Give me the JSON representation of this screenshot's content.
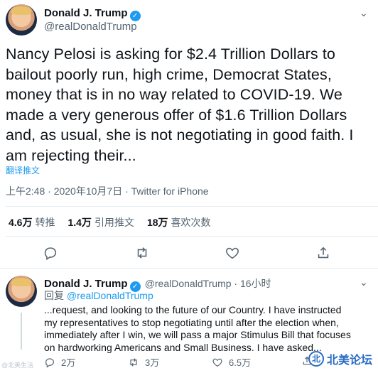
{
  "tweet": {
    "author_name": "Donald J. Trump",
    "handle": "@realDonaldTrump",
    "body_lines": [
      "Nancy Pelosi is asking for $2.4 Trillion Dollars to",
      "bailout poorly run, high crime, Democrat States,",
      "money that is in no way related to COVID-19. We",
      "made a very generous offer of $1.6 Trillion Dollars",
      "and, as usual, she is not negotiating in good faith. I",
      "am rejecting their..."
    ],
    "translate_label": "翻译推文",
    "timestamp": "上午2:48 · 2020年10月7日 · Twitter for iPhone",
    "stats": [
      {
        "value": "4.6万",
        "label": "转推"
      },
      {
        "value": "1.4万",
        "label": "引用推文"
      },
      {
        "value": "18万",
        "label": "喜欢次数"
      }
    ],
    "actions": [
      "reply-icon",
      "retweet-icon",
      "like-icon",
      "share-icon"
    ]
  },
  "reply": {
    "author_name": "Donald J. Trump",
    "handle_time": "@realDonaldTrump · 16小时",
    "reply_prefix": "回复",
    "reply_to": "@realDonaldTrump",
    "body_lines": [
      "...request, and looking to the future of our Country. I have instructed",
      "my representatives to stop negotiating until after the election when,",
      "immediately after I win, we will pass a major Stimulus Bill that focuses",
      "on hardworking Americans and Small Business. I have asked..."
    ],
    "reply_count": "2万",
    "retweet_count": "3万",
    "like_count": "6.5万"
  },
  "watermark": {
    "left_text": "@北美生活",
    "right_text": "北美论坛",
    "logo_text": "北"
  },
  "colors": {
    "accent": "#1d9bf0",
    "muted": "#536471",
    "text": "#0f1419"
  }
}
